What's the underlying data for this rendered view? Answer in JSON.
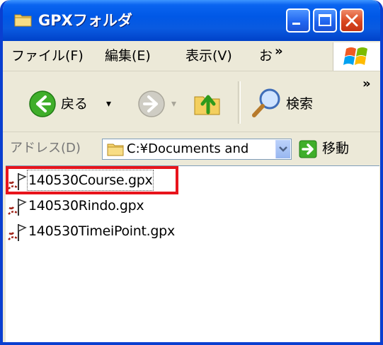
{
  "window": {
    "title": "GPXフォルダ",
    "folder_icon": "folder-icon",
    "controls": [
      "minimize-icon",
      "maximize-icon",
      "close-icon"
    ]
  },
  "menu": {
    "items": [
      {
        "label": "ファイル(F)"
      },
      {
        "label": "編集(E)"
      },
      {
        "label": "表示(V)"
      },
      {
        "label": "お"
      }
    ],
    "overflow": "»"
  },
  "toolbar": {
    "back_label": "戻る",
    "dropdown_glyph": "▾",
    "search_label": "検索",
    "overflow": "»"
  },
  "address": {
    "label": "アドレス(D)",
    "value": "C:¥Documents and",
    "go_label": "移動"
  },
  "files": [
    {
      "name": "140530Course.gpx",
      "selected": true
    },
    {
      "name": "140530Rindo.gpx",
      "selected": false
    },
    {
      "name": "140530TimeiPoint.gpx",
      "selected": false
    }
  ],
  "colors": {
    "titlebar": "#0058e6",
    "highlight": "#e8141c",
    "close_button": "#d9471f"
  }
}
